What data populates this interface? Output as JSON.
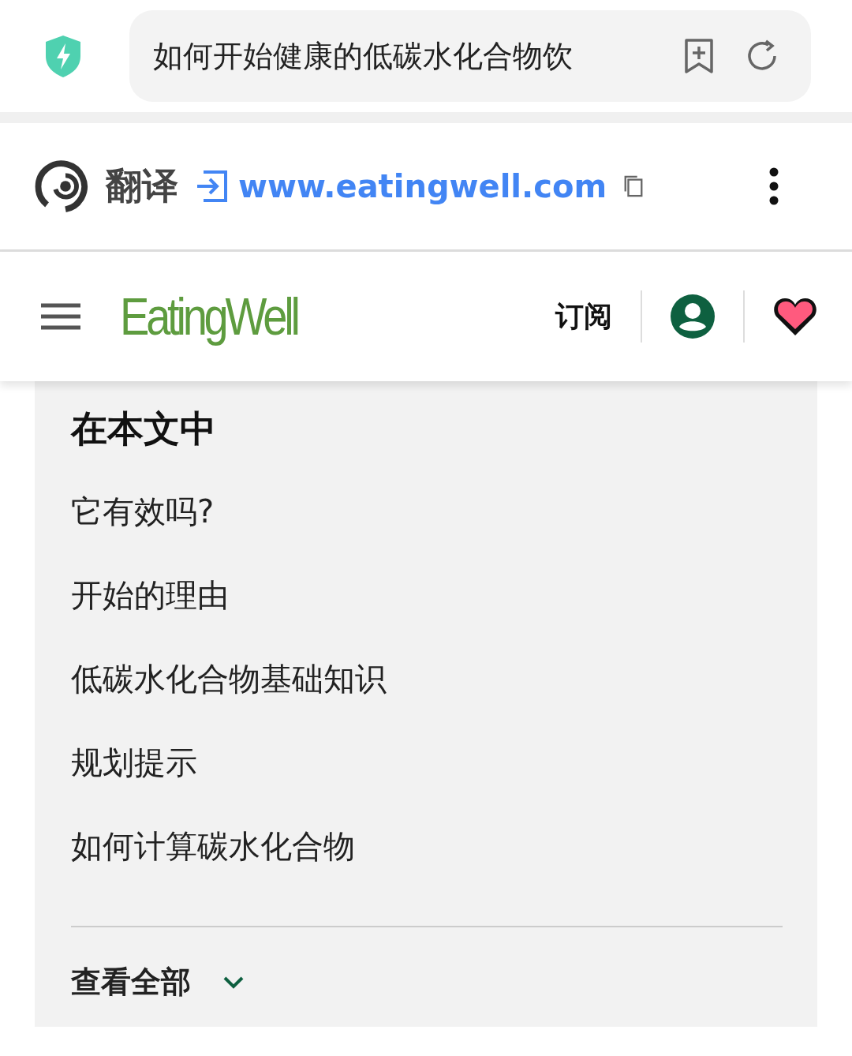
{
  "address_bar": {
    "query": "如何开始健康的低碳水化合物饮"
  },
  "translate_bar": {
    "label": "翻译",
    "url": "www.eatingwell.com"
  },
  "site_header": {
    "logo": "EatingWell",
    "subscribe": "订阅"
  },
  "toc": {
    "title": "在本文中",
    "items": [
      "它有效吗?",
      "开始的理由",
      "低碳水化合物基础知识",
      "规划提示",
      "如何计算碳水化合物"
    ],
    "view_all": "查看全部",
    "expanded": false
  }
}
